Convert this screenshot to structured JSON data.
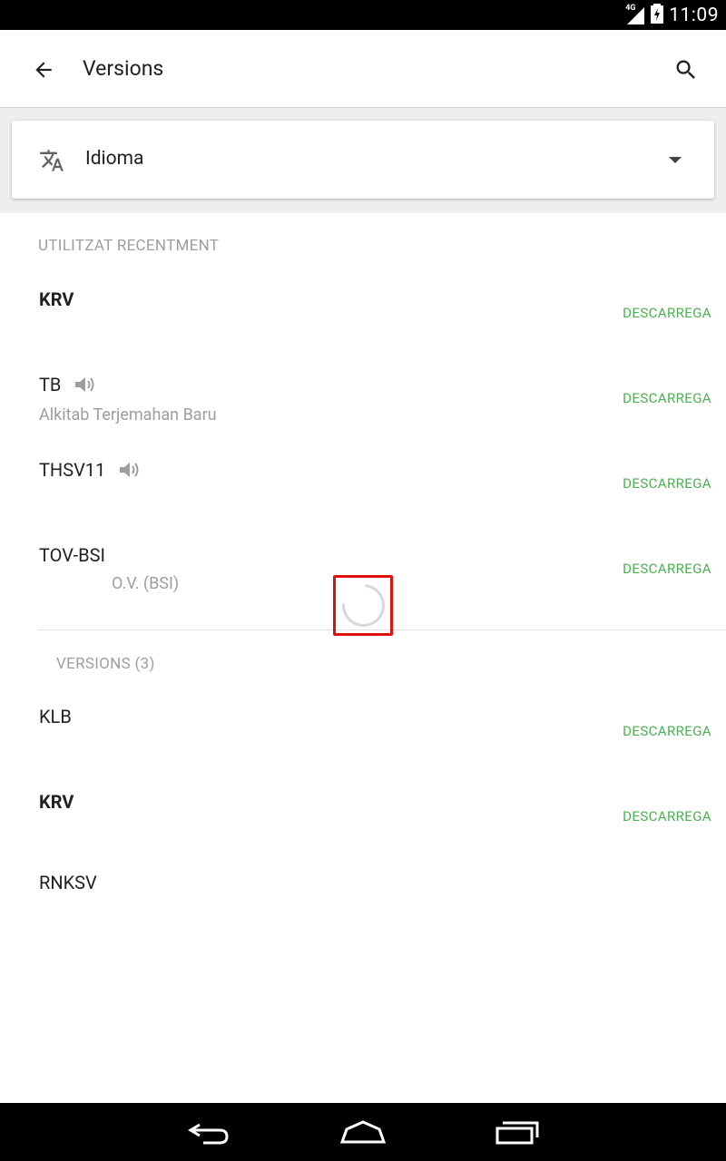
{
  "status_bar": {
    "network": "4G",
    "time": "11:09"
  },
  "app_bar": {
    "title": "Versions",
    "back_icon": "arrow-back-icon",
    "search_icon": "search-icon"
  },
  "language_selector": {
    "icon": "translate-icon",
    "label": "Idioma",
    "dropdown_icon": "arrow-drop-down-icon"
  },
  "recent": {
    "header": "UTILITZAT RECENTMENT",
    "items": [
      {
        "title": "KRV",
        "bold": true,
        "subtitle": "",
        "audio": false,
        "action": "DESCARREGA"
      },
      {
        "title": "TB",
        "bold": false,
        "subtitle": "Alkitab Terjemahan Baru",
        "audio": true,
        "action": "DESCARREGA"
      },
      {
        "title": "THSV11",
        "bold": false,
        "subtitle": "",
        "audio": true,
        "action": "DESCARREGA"
      },
      {
        "title": "TOV-BSI",
        "bold": false,
        "subtitle": "O.V. (BSI)",
        "audio": false,
        "action": "DESCARREGA"
      }
    ]
  },
  "versions": {
    "header": "VERSIONS (3)",
    "items": [
      {
        "title": "KLB",
        "bold": false,
        "action": "DESCARREGA"
      },
      {
        "title": "KRV",
        "bold": true,
        "action": "DESCARREGA"
      },
      {
        "title": "RNKSV",
        "bold": false,
        "action": ""
      }
    ]
  },
  "colors": {
    "accent_green": "#4caf50",
    "highlight_red": "#e0100f",
    "secondary_text": "#9e9e9e"
  },
  "nav_bar": {
    "back_icon": "nav-back-icon",
    "home_icon": "nav-home-icon",
    "recents_icon": "nav-recents-icon"
  }
}
